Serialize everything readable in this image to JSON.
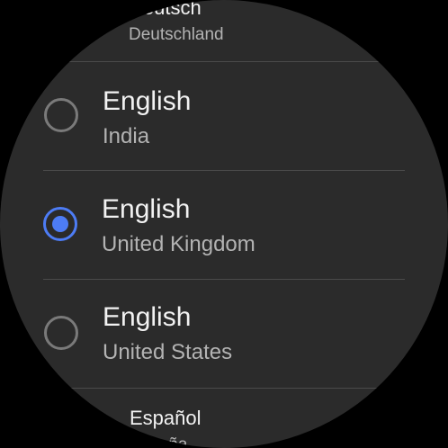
{
  "languages": [
    {
      "language": "Deutsch",
      "region": "Deutschland",
      "selected": false
    },
    {
      "language": "English",
      "region": "India",
      "selected": false
    },
    {
      "language": "English",
      "region": "United Kingdom",
      "selected": true
    },
    {
      "language": "English",
      "region": "United States",
      "selected": false
    },
    {
      "language": "Español",
      "region": "España",
      "selected": false
    }
  ],
  "colors": {
    "background": "#2b2b2b",
    "accent": "#4d7cf5",
    "primary_text": "#f2f2f2",
    "secondary_text": "#b3b3b3",
    "divider": "#4a4a4a"
  }
}
